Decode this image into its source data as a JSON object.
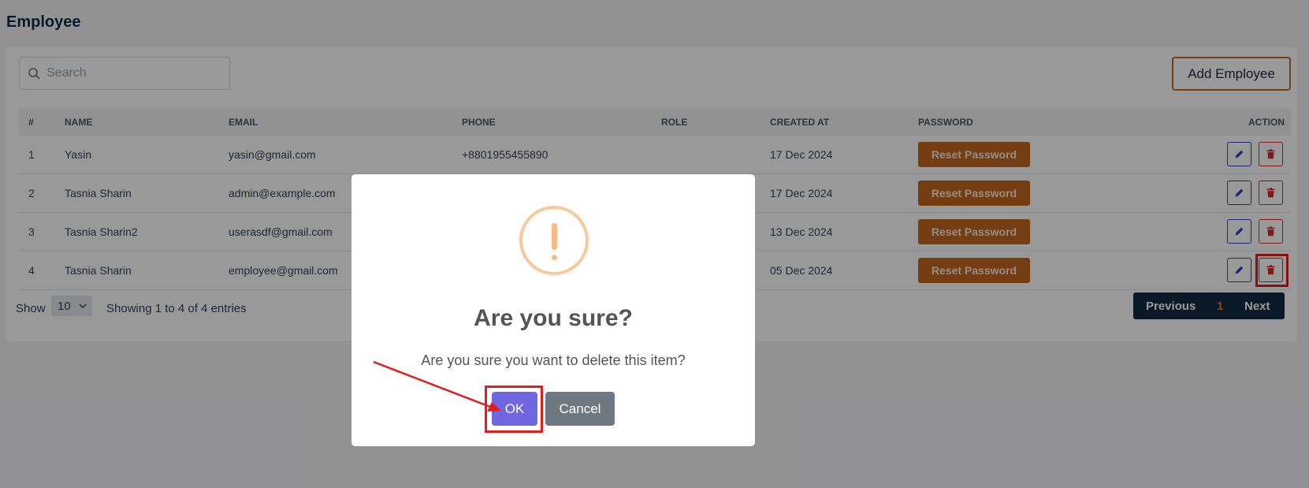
{
  "page": {
    "title": "Employee"
  },
  "search": {
    "placeholder": "Search"
  },
  "toolbar": {
    "add_label": "Add Employee"
  },
  "table": {
    "headers": {
      "num": "#",
      "name": "NAME",
      "email": "EMAIL",
      "phone": "PHONE",
      "role": "ROLE",
      "created": "CREATED AT",
      "password": "PASSWORD",
      "action": "ACTION"
    },
    "rows": [
      {
        "num": "1",
        "name": "Yasin",
        "email": "yasin@gmail.com",
        "phone": "+8801955455890",
        "role": "",
        "created": "17 Dec 2024",
        "reset": "Reset Password"
      },
      {
        "num": "2",
        "name": "Tasnia Sharin",
        "email": "admin@example.com",
        "phone": "",
        "role": "",
        "created": "17 Dec 2024",
        "reset": "Reset Password"
      },
      {
        "num": "3",
        "name": "Tasnia Sharin2",
        "email": "userasdf@gmail.com",
        "phone": "",
        "role": "",
        "created": "13 Dec 2024",
        "reset": "Reset Password"
      },
      {
        "num": "4",
        "name": "Tasnia Sharin",
        "email": "employee@gmail.com",
        "phone": "",
        "role": "",
        "created": "05 Dec 2024",
        "reset": "Reset Password"
      }
    ]
  },
  "footer": {
    "show_label": "Show",
    "page_size": "10",
    "showing": "Showing 1 to 4 of 4 entries",
    "pager": {
      "previous": "Previous",
      "current": "1",
      "next": "Next"
    }
  },
  "modal": {
    "title": "Are you sure?",
    "text": "Are you sure you want to delete this item?",
    "ok_label": "OK",
    "cancel_label": "Cancel"
  },
  "icons": {
    "search": "search-icon",
    "edit": "pencil-icon",
    "delete": "trash-icon",
    "warning": "exclamation-icon",
    "dropdown": "chevron-down-icon"
  },
  "colors": {
    "accent": "#c2671e",
    "primary": "#0f2a44",
    "ok": "#7066e0",
    "cancel": "#6e7881",
    "danger": "#dc2626",
    "edit": "#4338ca",
    "warning": "#f8bb86",
    "annotation": "#e11d1d"
  }
}
